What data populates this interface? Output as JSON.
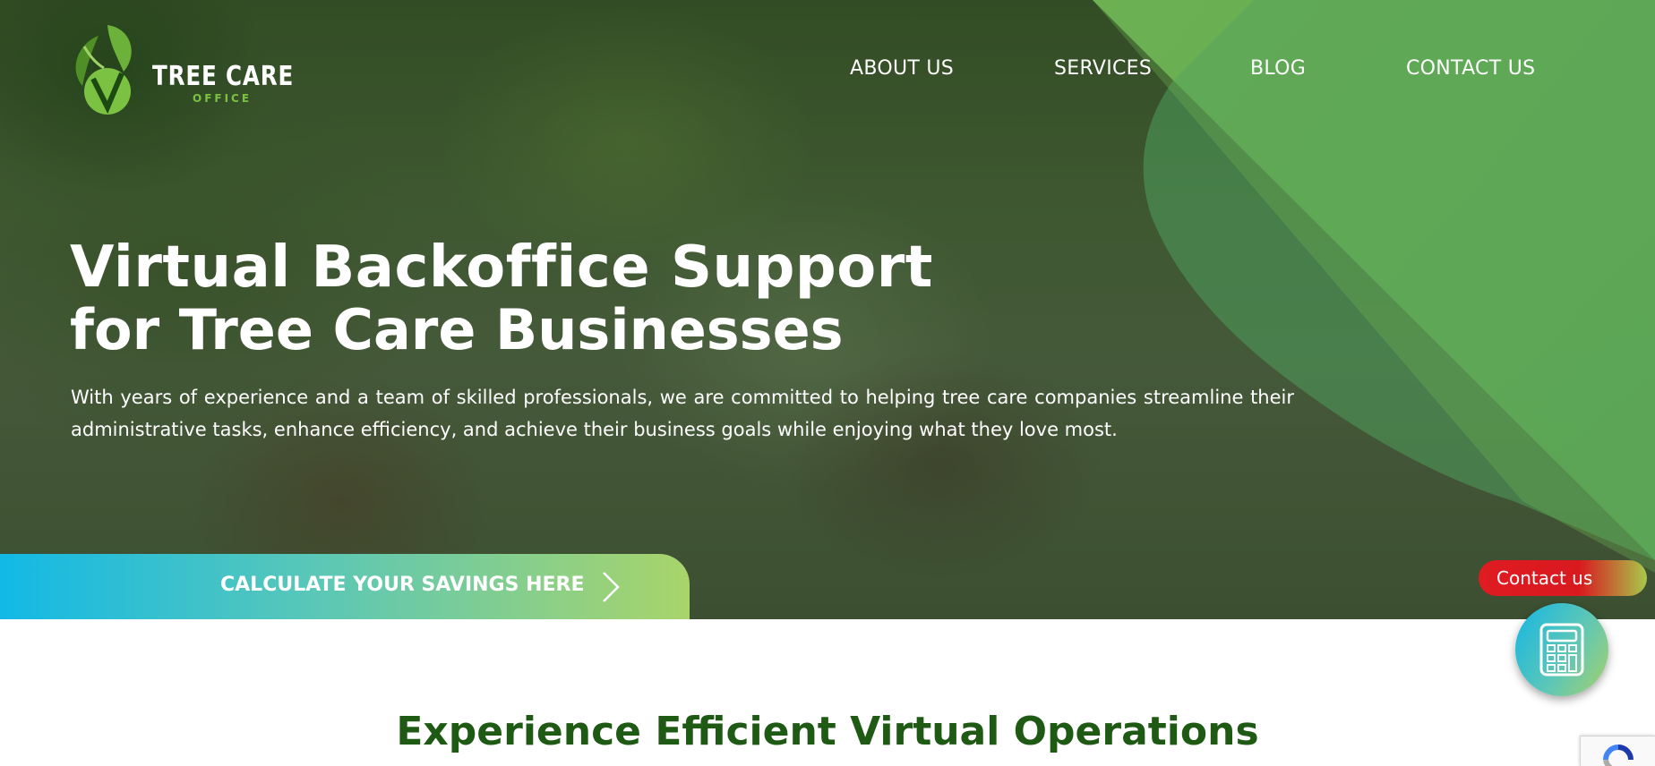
{
  "brand": {
    "name": "TREE CARE",
    "sub": "OFFICE"
  },
  "nav": {
    "items": [
      {
        "label": "ABOUT US"
      },
      {
        "label": "SERVICES"
      },
      {
        "label": "BLOG"
      },
      {
        "label": "CONTACT US"
      }
    ]
  },
  "hero": {
    "headline": "Virtual Backoffice Support",
    "subheadline": "for Tree Care Businesses",
    "description": "With years of experience and a team of skilled professionals, we are committed to helping tree care companies streamline their administrative tasks, enhance efficiency, and achieve their business goals while enjoying what they love most.",
    "cta_label": "CALCULATE YOUR SAVINGS HERE",
    "cta_icon": "chevron-right-icon"
  },
  "widgets": {
    "contact_label": "Contact us",
    "calculator_icon": "calculator-icon",
    "recaptcha_icon": "recaptcha-icon"
  },
  "section": {
    "title": "Experience Efficient Virtual Operations"
  },
  "colors": {
    "brand_green": "#6aaf4a",
    "dark_green_text": "#1f5a14",
    "logo_green": "#7cc242",
    "cta_start": "#12b9e6",
    "cta_end": "#a9d46a",
    "contact_red": "#e01b22"
  }
}
